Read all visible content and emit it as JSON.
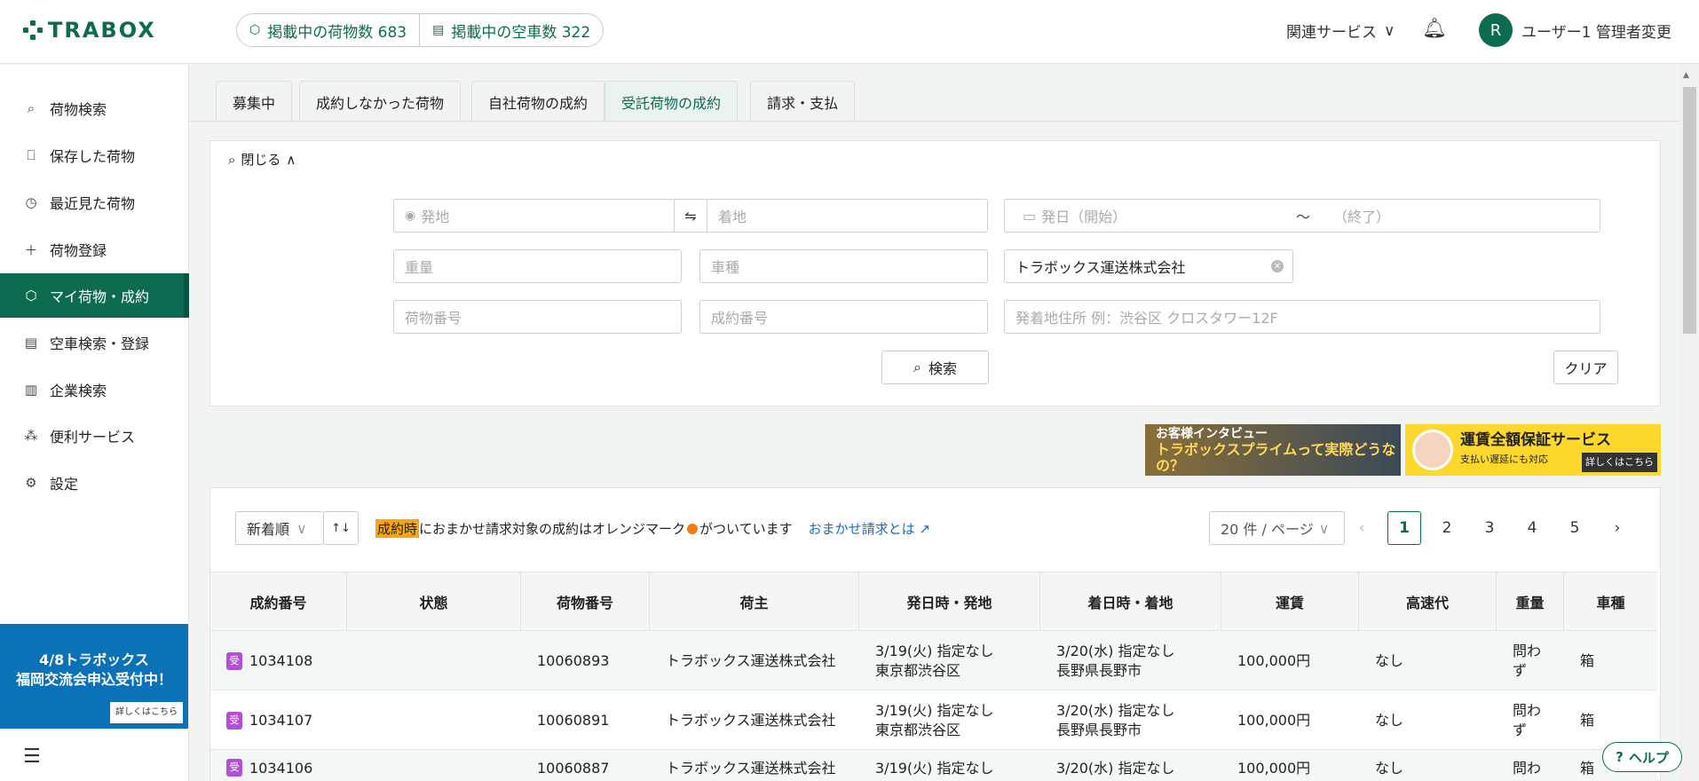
{
  "header": {
    "logo": "TRABOX",
    "cargo_count_label": "掲載中の荷物数 683",
    "truck_count_label": "掲載中の空車数 322",
    "related_services": "関連サービス",
    "avatar_letter": "R",
    "user_label": "ユーザー1 管理者変更"
  },
  "sidebar": {
    "items": [
      {
        "label": "荷物検索",
        "icon": "search-icon"
      },
      {
        "label": "保存した荷物",
        "icon": "bookmark-icon"
      },
      {
        "label": "最近見た荷物",
        "icon": "history-icon"
      },
      {
        "label": "荷物登録",
        "icon": "plus-icon"
      },
      {
        "label": "マイ荷物・成約",
        "icon": "box-icon"
      },
      {
        "label": "空車検索・登録",
        "icon": "truck-icon"
      },
      {
        "label": "企業検索",
        "icon": "building-icon"
      },
      {
        "label": "便利サービス",
        "icon": "network-icon"
      },
      {
        "label": "設定",
        "icon": "gear-icon"
      }
    ],
    "promo_line1": "4/8トラボックス",
    "promo_line2": "福岡交流会申込受付中！",
    "promo_more": "詳しくはこちら"
  },
  "tabs": [
    "募集中",
    "成約しなかった荷物",
    "自社荷物の成約",
    "受託荷物の成約",
    "請求・支払"
  ],
  "search": {
    "toggle_label": "閉じる",
    "origin_placeholder": "発地",
    "dest_placeholder": "着地",
    "date_start_placeholder": "発日（開始）",
    "date_tilde": "～",
    "date_end_placeholder": "（終了）",
    "weight_placeholder": "重量",
    "vehicle_placeholder": "車種",
    "shipper_value": "トラボックス運送株式会社",
    "cargo_no_placeholder": "荷物番号",
    "contract_no_placeholder": "成約番号",
    "address_placeholder": "発着地住所 例：渋谷区 クロスタワー12F",
    "search_button": "検索",
    "clear_button": "クリア"
  },
  "banners": {
    "interview_title": "お客様インタビュー",
    "interview_sub": "トラボックスプライムって実際どうなの？",
    "guarantee_title": "運賃全額保証サービス",
    "guarantee_sub": "支払い遅延にも対応",
    "guarantee_more": "詳しくはこちら"
  },
  "list": {
    "sort_label": "新着順",
    "sort_dir_label": "↑↓",
    "note_highlight": "成約時",
    "note_text1": "におまかせ請求対象の成約はオレンジマーク",
    "note_text2": "がついています",
    "note_link": "おまかせ請求とは",
    "per_page": "20 件 / ページ",
    "pages": [
      "1",
      "2",
      "3",
      "4",
      "5"
    ],
    "current_page": "1"
  },
  "table": {
    "columns": [
      "成約番号",
      "状態",
      "荷物番号",
      "荷主",
      "発日時・発地",
      "着日時・着地",
      "運賃",
      "高速代",
      "重量",
      "車種"
    ],
    "rows": [
      {
        "badge": "受",
        "contract_no": "1034108",
        "status": "",
        "cargo_no": "10060893",
        "shipper": "トラボックス運送株式会社",
        "dep_date": "3/19(火) 指定なし",
        "dep_place": "東京都渋谷区",
        "arr_date": "3/20(水) 指定なし",
        "arr_place": "長野県長野市",
        "fare": "100,000円",
        "toll": "なし",
        "weight_1": "問わ",
        "weight_2": "ず",
        "vehicle": "箱"
      },
      {
        "badge": "受",
        "contract_no": "1034107",
        "status": "",
        "cargo_no": "10060891",
        "shipper": "トラボックス運送株式会社",
        "dep_date": "3/19(火) 指定なし",
        "dep_place": "東京都渋谷区",
        "arr_date": "3/20(水) 指定なし",
        "arr_place": "長野県長野市",
        "fare": "100,000円",
        "toll": "なし",
        "weight_1": "問わ",
        "weight_2": "ず",
        "vehicle": "箱"
      },
      {
        "badge": "受",
        "contract_no": "1034106",
        "status": "",
        "cargo_no": "10060887",
        "shipper": "トラボックス運送株式会社",
        "dep_date": "3/19(火) 指定なし",
        "dep_place": "",
        "arr_date": "3/20(水) 指定なし",
        "arr_place": "",
        "fare": "100,000円",
        "toll": "なし",
        "weight_1": "問わ",
        "weight_2": "",
        "vehicle": "箱"
      }
    ]
  },
  "help_label": "ヘルプ",
  "colors": {
    "brand": "#0d6b52",
    "highlight": "#f7a70d",
    "orange_mark": "#f07c10",
    "link": "#1a6bc2",
    "badge": "#b24fd6"
  }
}
